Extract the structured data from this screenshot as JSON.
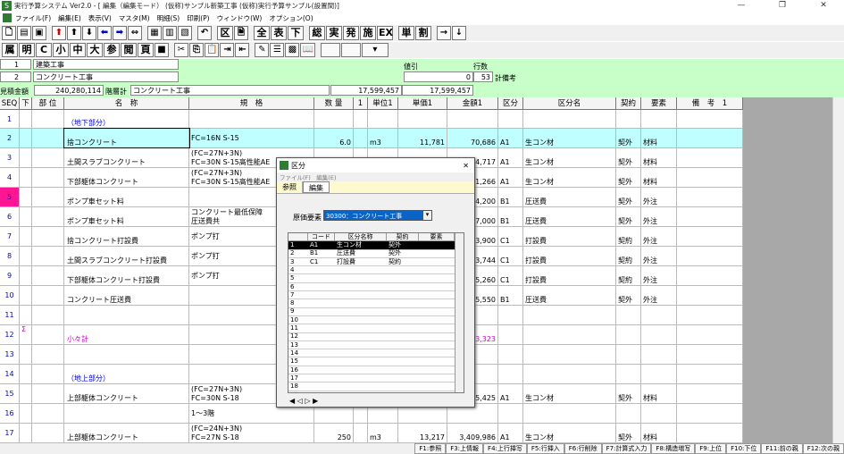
{
  "window": {
    "title": "実行予算システム Ver2.0 - [ 編集（編集モード） (仮称)サンプル新築工事 (仮称)実行予算サンプル(設置間)]",
    "min": "—",
    "max": "❐",
    "close": "✕"
  },
  "menu": [
    "ファイル(F)",
    "編集(E)",
    "表示(V)",
    "マスタ(M)",
    "明細(S)",
    "印刷(P)",
    "ウィンドウ(W)",
    "オプション(O)"
  ],
  "toolbar2": [
    "属",
    "明",
    "C",
    "小",
    "中",
    "大",
    "参",
    "閲",
    "頁"
  ],
  "toolbar1": [
    "区",
    "全",
    "表",
    "下",
    "総",
    "実",
    "発",
    "施",
    "EX",
    "単",
    "割"
  ],
  "header": {
    "row1_no": "1",
    "row1_name": "建築工事",
    "row2_no": "2",
    "row2_name": "コンクリート工事",
    "neibiki_label": "値引",
    "neibiki_val": "0",
    "gyosu_label": "行数",
    "gyosu_val": "53",
    "keibiko": "計備考",
    "mitsumori_label": "見積金額",
    "mitsumori_val": "240,280,114",
    "kaisokei_label": "階層計",
    "kaisokei_name": "コンクリート工事",
    "amount1": "17,599,457",
    "amount2": "17,599,457"
  },
  "columns": [
    "SEQ",
    "下",
    "部 位",
    "名　称",
    "規　格",
    "数 量",
    "1",
    "単位1",
    "単価1",
    "金額1",
    "区分",
    "区分名",
    "契約",
    "要素",
    "備　考　1"
  ],
  "rows": [
    {
      "seq": "1",
      "name": "（地下部分）",
      "spec": "",
      "qty": "",
      "unit": "",
      "price": "",
      "amount": "",
      "kubun": "",
      "kubunname": "",
      "keiyaku": "",
      "yoso": "",
      "h": 21,
      "bg": "#fff",
      "color": "#00c"
    },
    {
      "seq": "2",
      "name": "捨コンクリート",
      "spec": "FC=16N S-15",
      "qty": "6.0",
      "unit": "m3",
      "price": "11,781",
      "amount": "70,686",
      "kubun": "A1",
      "kubunname": "生コン材",
      "keiyaku": "契外",
      "yoso": "材料",
      "h": 22,
      "bg": "#bfffff",
      "color": "#000"
    },
    {
      "seq": "3",
      "name": "土間スラブコンクリート",
      "spec": "(FC=27N+3N)\nFC=30N S-15高性能AE",
      "qty": "",
      "unit": "",
      "price": "",
      "amount": "4,717",
      "kubun": "A1",
      "kubunname": "生コン材",
      "keiyaku": "契外",
      "yoso": "材料",
      "h": 22,
      "bg": "#fff",
      "color": "#000"
    },
    {
      "seq": "4",
      "name": "下部躯体コンクリート",
      "spec": "(FC=27N+3N)\nFC=30N S-15高性能AE",
      "qty": "",
      "unit": "",
      "price": "",
      "amount": "1,266",
      "kubun": "A1",
      "kubunname": "生コン材",
      "keiyaku": "契外",
      "yoso": "材料",
      "h": 22,
      "bg": "#fff",
      "color": "#000"
    },
    {
      "seq": "5",
      "name": "ポンプ車セット料",
      "spec": "",
      "qty": "",
      "unit": "",
      "price": "",
      "amount": "4,200",
      "kubun": "B1",
      "kubunname": "圧送費",
      "keiyaku": "契外",
      "yoso": "外注",
      "h": 22,
      "bg": "#fff",
      "color": "#000",
      "mark": true
    },
    {
      "seq": "6",
      "name": "ポンプ車セット料",
      "spec": "コンクリート最低保障\n圧送費共",
      "qty": "",
      "unit": "",
      "price": "",
      "amount": "7,000",
      "kubun": "B1",
      "kubunname": "圧送費",
      "keiyaku": "契外",
      "yoso": "外注",
      "h": 22,
      "bg": "#fff",
      "color": "#000"
    },
    {
      "seq": "7",
      "name": "捨コンクリート打設費",
      "spec": "ポンプ打",
      "qty": "",
      "unit": "",
      "price": "",
      "amount": "3,900",
      "kubun": "C1",
      "kubunname": "打設費",
      "keiyaku": "契約",
      "yoso": "外注",
      "h": 22,
      "bg": "#fff",
      "color": "#000"
    },
    {
      "seq": "8",
      "name": "土間スラブコンクリート打設費",
      "spec": "ポンプ打",
      "qty": "",
      "unit": "",
      "price": "",
      "amount": "3,744",
      "kubun": "C1",
      "kubunname": "打設費",
      "keiyaku": "契約",
      "yoso": "外注",
      "h": 22,
      "bg": "#fff",
      "color": "#000"
    },
    {
      "seq": "9",
      "name": "下部躯体コンクリート打設費",
      "spec": "ポンプ打",
      "qty": "",
      "unit": "",
      "price": "",
      "amount": "5,260",
      "kubun": "C1",
      "kubunname": "打設費",
      "keiyaku": "契約",
      "yoso": "外注",
      "h": 22,
      "bg": "#fff",
      "color": "#000"
    },
    {
      "seq": "10",
      "name": "コンクリート圧送費",
      "spec": "",
      "qty": "",
      "unit": "",
      "price": "",
      "amount": "5,550",
      "kubun": "B1",
      "kubunname": "圧送費",
      "keiyaku": "契外",
      "yoso": "外注",
      "h": 22,
      "bg": "#fff",
      "color": "#000"
    },
    {
      "seq": "11",
      "name": "",
      "spec": "",
      "qty": "",
      "unit": "",
      "price": "",
      "amount": "",
      "kubun": "",
      "kubunname": "",
      "keiyaku": "",
      "yoso": "",
      "h": 22,
      "bg": "#fff",
      "color": "#000"
    },
    {
      "seq": "12",
      "name": "小々計",
      "spec": "",
      "qty": "",
      "unit": "",
      "price": "",
      "amount": "3,323",
      "kubun": "",
      "kubunname": "",
      "keiyaku": "",
      "yoso": "",
      "h": 22,
      "bg": "#fff",
      "color": "#c0c",
      "sigma": "Σ"
    },
    {
      "seq": "13",
      "name": "",
      "spec": "",
      "qty": "",
      "unit": "",
      "price": "",
      "amount": "",
      "kubun": "",
      "kubunname": "",
      "keiyaku": "",
      "yoso": "",
      "h": 22,
      "bg": "#fff",
      "color": "#000"
    },
    {
      "seq": "14",
      "name": "（地上部分）",
      "spec": "",
      "qty": "",
      "unit": "",
      "price": "",
      "amount": "",
      "kubun": "",
      "kubunname": "",
      "keiyaku": "",
      "yoso": "",
      "h": 22,
      "bg": "#fff",
      "color": "#00c"
    },
    {
      "seq": "15",
      "name": "上部躯体コンクリート",
      "spec": "(FC=27N+3N)\nFC=30N S-18",
      "qty": "",
      "unit": "",
      "price": "",
      "amount": "5,425",
      "kubun": "A1",
      "kubunname": "生コン材",
      "keiyaku": "契外",
      "yoso": "材料",
      "h": 22,
      "bg": "#fff",
      "color": "#000"
    },
    {
      "seq": "16",
      "name": "",
      "spec": "1～3階",
      "qty": "",
      "unit": "",
      "price": "",
      "amount": "",
      "kubun": "",
      "kubunname": "",
      "keiyaku": "",
      "yoso": "",
      "h": 22,
      "bg": "#fff",
      "color": "#000"
    },
    {
      "seq": "17",
      "name": "上部躯体コンクリート",
      "spec": "(FC=24N+3N)\nFC=27N S-18",
      "qty": "250",
      "unit": "m3",
      "price": "13,217",
      "amount": "3,409,986",
      "kubun": "A1",
      "kubunname": "生コン材",
      "keiyaku": "契外",
      "yoso": "材料",
      "h": 22,
      "bg": "#fff",
      "color": "#000"
    }
  ],
  "dialog": {
    "title": "区分",
    "close": "✕",
    "menu": "ファイル(F)　編集(E)",
    "tabs": [
      "参照",
      "編集"
    ],
    "genka_label": "原価要素",
    "genka_value": "30300：コンクリート工事",
    "cols": [
      "コード",
      "区分名称",
      "契約",
      "要素"
    ],
    "rows": [
      {
        "n": "1",
        "code": "A1",
        "name": "生コン材",
        "keiyaku": "契外",
        "yoso": ""
      },
      {
        "n": "2",
        "code": "B1",
        "name": "圧送費",
        "keiyaku": "契外",
        "yoso": ""
      },
      {
        "n": "3",
        "code": "C1",
        "name": "打設費",
        "keiyaku": "契約",
        "yoso": ""
      },
      {
        "n": "4"
      },
      {
        "n": "5"
      },
      {
        "n": "6"
      },
      {
        "n": "7"
      },
      {
        "n": "8"
      },
      {
        "n": "9"
      },
      {
        "n": "10"
      },
      {
        "n": "11"
      },
      {
        "n": "12"
      },
      {
        "n": "13"
      },
      {
        "n": "14"
      },
      {
        "n": "15"
      },
      {
        "n": "16"
      },
      {
        "n": "17"
      },
      {
        "n": "18"
      }
    ]
  },
  "fkeys": [
    "F1:参照",
    "F3:上情報",
    "F4:上行挿写",
    "F5:行挿入",
    "F6:行削除",
    "F7:計算式入力",
    "F8:構造増写",
    "F9:上位",
    "F10:下位",
    "F11:前の親",
    "F12:次の親"
  ]
}
